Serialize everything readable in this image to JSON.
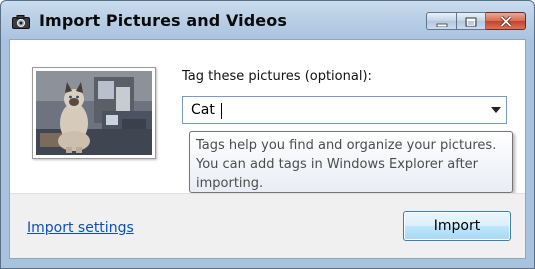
{
  "window": {
    "title": "Import Pictures and Videos",
    "icons": {
      "app": "camera-icon",
      "minimize": "minimize-icon",
      "maximize": "maximize-icon",
      "close": "close-icon"
    }
  },
  "tags": {
    "label": "Tag these pictures (optional):",
    "value": "Cat"
  },
  "tooltip": {
    "lines": [
      "Tags help you find and organize your pictures.",
      "You can add tags in Windows Explorer after",
      "importing."
    ]
  },
  "footer": {
    "settings_link": "Import settings",
    "import_button": "Import"
  },
  "colors": {
    "link": "#0b4fc4",
    "title_bar": "#b9cfe6",
    "close_button": "#c2432a"
  }
}
